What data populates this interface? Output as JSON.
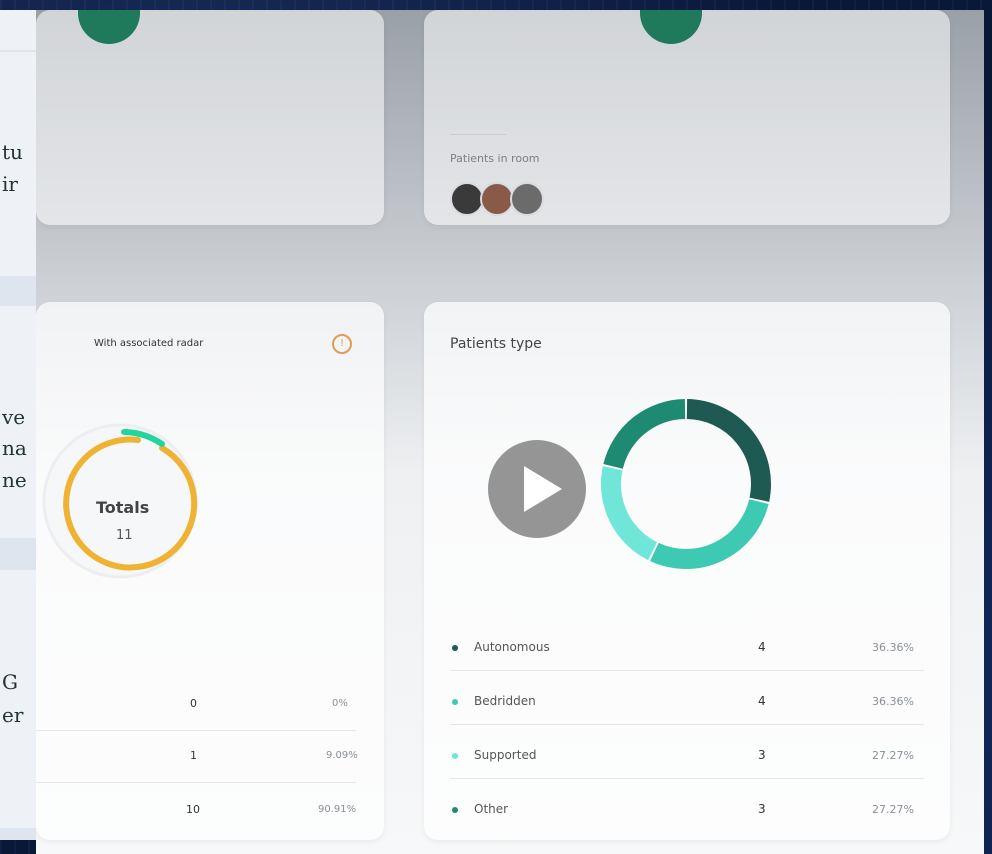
{
  "background_document": {
    "fragments": [
      "tu",
      "ir",
      "ve",
      "na",
      "ne",
      "G",
      "er"
    ]
  },
  "patients_card": {
    "label": "Patients in room",
    "avatars": [
      "patient-avatar-1",
      "patient-avatar-2",
      "patient-avatar-3"
    ]
  },
  "radar_card": {
    "title": "With associated radar",
    "info_icon": "!",
    "totals_label": "Totals",
    "totals_value": "11",
    "rows": [
      {
        "count": "0",
        "percent": "0%"
      },
      {
        "count": "1",
        "percent": "9.09%"
      },
      {
        "count": "10",
        "percent": "90.91%"
      }
    ]
  },
  "patients_type_card": {
    "title": "Patients type",
    "legend": [
      {
        "label": "Autonomous",
        "count": "4",
        "percent": "36.36%",
        "color": "#1f5a52"
      },
      {
        "label": "Bedridden",
        "count": "4",
        "percent": "36.36%",
        "color": "#3ec9b3"
      },
      {
        "label": "Supported",
        "count": "3",
        "percent": "27.27%",
        "color": "#6fe6d8"
      },
      {
        "label": "Other",
        "count": "3",
        "percent": "27.27%",
        "color": "#1e8a72"
      }
    ]
  },
  "colors": {
    "ring_orange": "#f0b232",
    "ring_green": "#23d49e",
    "accent_shield": "#1e7a5a"
  }
}
